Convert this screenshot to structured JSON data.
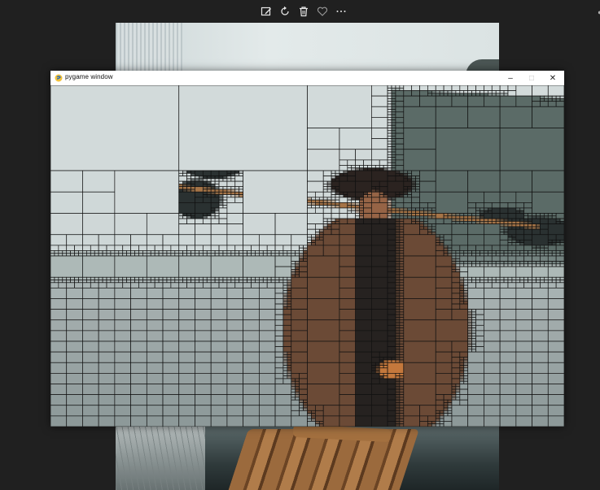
{
  "viewer_toolbar": {
    "buttons": [
      {
        "name": "edit-image-icon",
        "glyph": "✎"
      },
      {
        "name": "rotate-icon",
        "glyph": "↻"
      },
      {
        "name": "delete-icon",
        "glyph": "🗑"
      },
      {
        "name": "favorite-icon",
        "glyph": "♡"
      },
      {
        "name": "more-options-icon",
        "glyph": "···"
      }
    ]
  },
  "pygame_window": {
    "title": "pygame window",
    "controls": {
      "minimize": "–",
      "maximize": "□",
      "close": "✕"
    }
  },
  "colors": {
    "viewer_background": "#202020",
    "grid_line": "#111111",
    "sky": "#d3dbdb",
    "water": "#8c9898",
    "mountain": "#5b6b67",
    "cormorant": "#2a3131",
    "hat": "#2b2320",
    "coat": "#6b4a36",
    "pole": "#a57447"
  }
}
